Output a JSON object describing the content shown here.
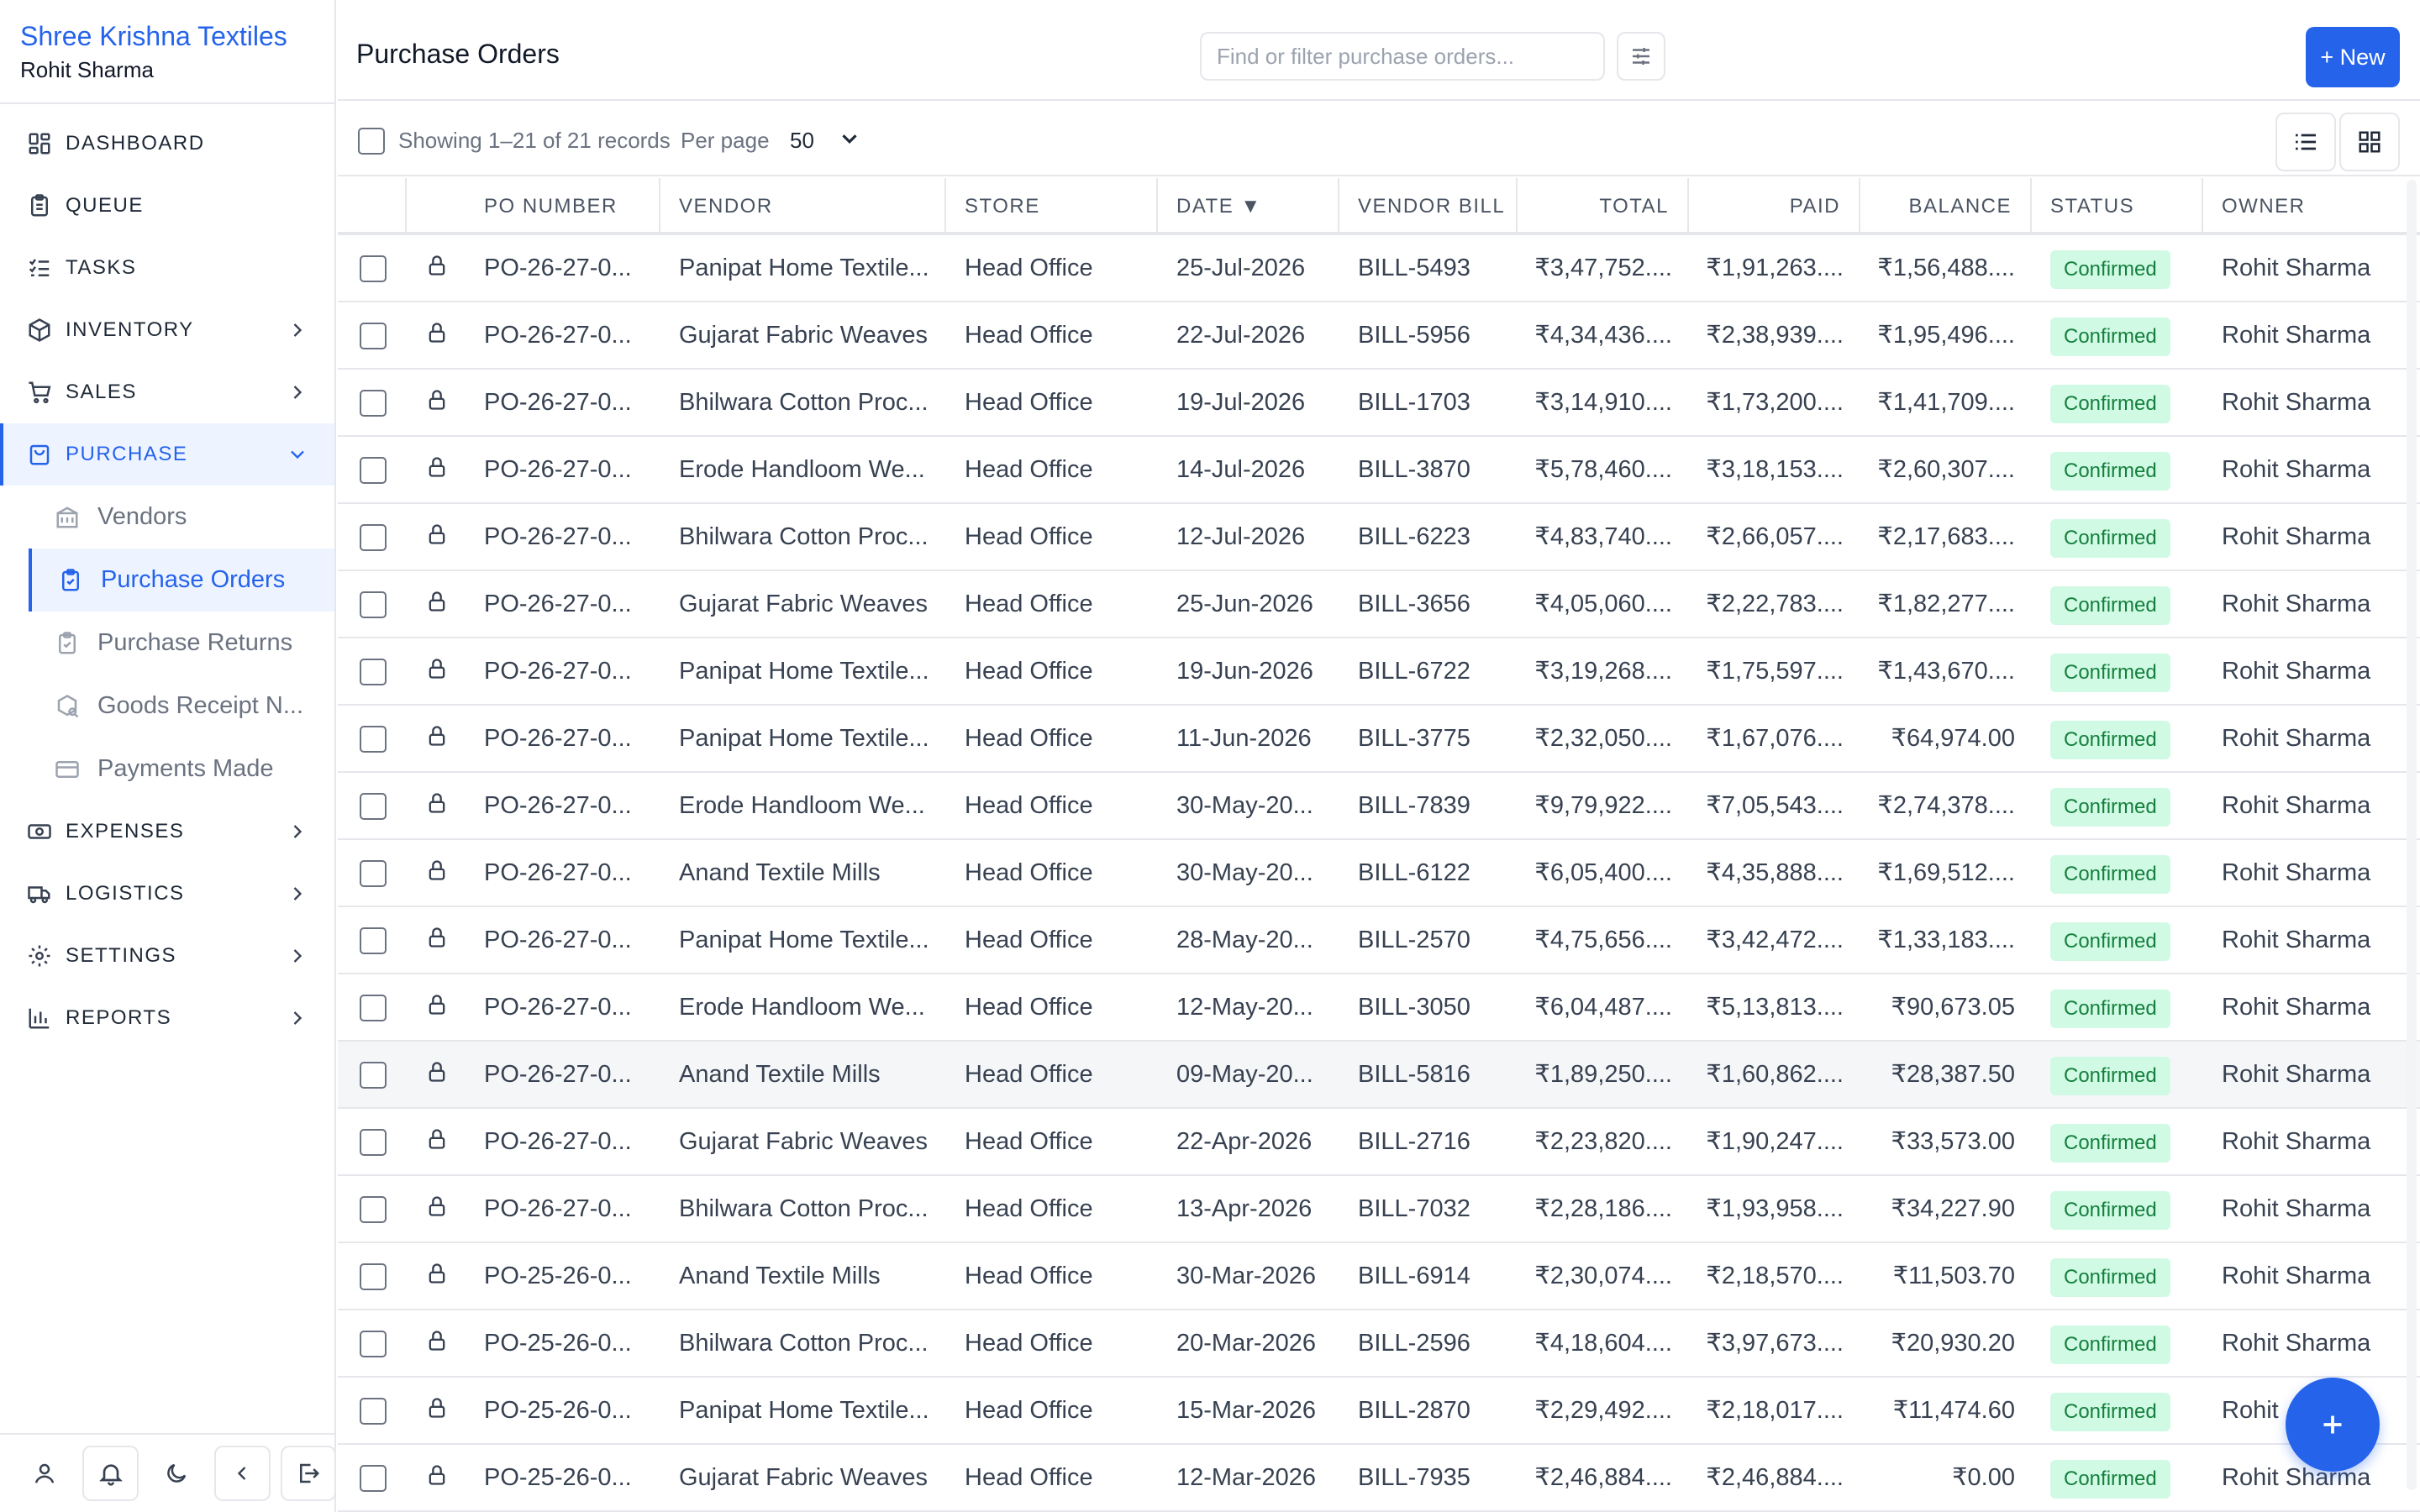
{
  "sidebar": {
    "org_name": "Shree Krishna Textiles",
    "user_name": "Rohit Sharma",
    "nav": [
      {
        "label": "DASHBOARD",
        "icon": "dashboard-icon"
      },
      {
        "label": "QUEUE",
        "icon": "clipboard-icon"
      },
      {
        "label": "TASKS",
        "icon": "list-check-icon"
      },
      {
        "label": "INVENTORY",
        "icon": "box-icon"
      },
      {
        "label": "SALES",
        "icon": "cart-icon"
      },
      {
        "label": "PURCHASE",
        "icon": "bag-icon"
      },
      {
        "label": "EXPENSES",
        "icon": "cash-icon"
      },
      {
        "label": "LOGISTICS",
        "icon": "truck-icon"
      },
      {
        "label": "SETTINGS",
        "icon": "gear-icon"
      },
      {
        "label": "REPORTS",
        "icon": "bar-chart-icon"
      }
    ],
    "purchase_sub": [
      {
        "label": "Vendors"
      },
      {
        "label": "Purchase Orders"
      },
      {
        "label": "Purchase Returns"
      },
      {
        "label": "Goods Receipt N..."
      },
      {
        "label": "Payments Made"
      }
    ]
  },
  "header": {
    "title": "Purchase Orders",
    "search_placeholder": "Find or filter purchase orders...",
    "new_label": "+ New"
  },
  "toolbar": {
    "showing": "Showing 1–21 of 21 records",
    "per_page_label": "Per page",
    "per_page_value": "50"
  },
  "table": {
    "columns": {
      "po_number": "PO NUMBER",
      "vendor": "VENDOR",
      "store": "STORE",
      "date": "DATE ▼",
      "vendor_bill": "VENDOR BILL",
      "total": "TOTAL",
      "paid": "PAID",
      "balance": "BALANCE",
      "status": "STATUS",
      "owner": "OWNER"
    },
    "rows": [
      {
        "po": "PO-26-27-0...",
        "vendor": "Panipat Home Textile...",
        "store": "Head Office",
        "date": "25-Jul-2026",
        "bill": "BILL-5493",
        "total": "₹3,47,752....",
        "paid": "₹1,91,263....",
        "balance": "₹1,56,488....",
        "status": "Confirmed",
        "owner": "Rohit Sharma"
      },
      {
        "po": "PO-26-27-0...",
        "vendor": "Gujarat Fabric Weaves",
        "store": "Head Office",
        "date": "22-Jul-2026",
        "bill": "BILL-5956",
        "total": "₹4,34,436....",
        "paid": "₹2,38,939....",
        "balance": "₹1,95,496....",
        "status": "Confirmed",
        "owner": "Rohit Sharma"
      },
      {
        "po": "PO-26-27-0...",
        "vendor": "Bhilwara Cotton Proc...",
        "store": "Head Office",
        "date": "19-Jul-2026",
        "bill": "BILL-1703",
        "total": "₹3,14,910....",
        "paid": "₹1,73,200....",
        "balance": "₹1,41,709....",
        "status": "Confirmed",
        "owner": "Rohit Sharma"
      },
      {
        "po": "PO-26-27-0...",
        "vendor": "Erode Handloom We...",
        "store": "Head Office",
        "date": "14-Jul-2026",
        "bill": "BILL-3870",
        "total": "₹5,78,460....",
        "paid": "₹3,18,153....",
        "balance": "₹2,60,307....",
        "status": "Confirmed",
        "owner": "Rohit Sharma"
      },
      {
        "po": "PO-26-27-0...",
        "vendor": "Bhilwara Cotton Proc...",
        "store": "Head Office",
        "date": "12-Jul-2026",
        "bill": "BILL-6223",
        "total": "₹4,83,740....",
        "paid": "₹2,66,057....",
        "balance": "₹2,17,683....",
        "status": "Confirmed",
        "owner": "Rohit Sharma"
      },
      {
        "po": "PO-26-27-0...",
        "vendor": "Gujarat Fabric Weaves",
        "store": "Head Office",
        "date": "25-Jun-2026",
        "bill": "BILL-3656",
        "total": "₹4,05,060....",
        "paid": "₹2,22,783....",
        "balance": "₹1,82,277....",
        "status": "Confirmed",
        "owner": "Rohit Sharma"
      },
      {
        "po": "PO-26-27-0...",
        "vendor": "Panipat Home Textile...",
        "store": "Head Office",
        "date": "19-Jun-2026",
        "bill": "BILL-6722",
        "total": "₹3,19,268....",
        "paid": "₹1,75,597....",
        "balance": "₹1,43,670....",
        "status": "Confirmed",
        "owner": "Rohit Sharma"
      },
      {
        "po": "PO-26-27-0...",
        "vendor": "Panipat Home Textile...",
        "store": "Head Office",
        "date": "11-Jun-2026",
        "bill": "BILL-3775",
        "total": "₹2,32,050....",
        "paid": "₹1,67,076....",
        "balance": "₹64,974.00",
        "status": "Confirmed",
        "owner": "Rohit Sharma"
      },
      {
        "po": "PO-26-27-0...",
        "vendor": "Erode Handloom We...",
        "store": "Head Office",
        "date": "30-May-20...",
        "bill": "BILL-7839",
        "total": "₹9,79,922....",
        "paid": "₹7,05,543....",
        "balance": "₹2,74,378....",
        "status": "Confirmed",
        "owner": "Rohit Sharma"
      },
      {
        "po": "PO-26-27-0...",
        "vendor": "Anand Textile Mills",
        "store": "Head Office",
        "date": "30-May-20...",
        "bill": "BILL-6122",
        "total": "₹6,05,400....",
        "paid": "₹4,35,888....",
        "balance": "₹1,69,512....",
        "status": "Confirmed",
        "owner": "Rohit Sharma"
      },
      {
        "po": "PO-26-27-0...",
        "vendor": "Panipat Home Textile...",
        "store": "Head Office",
        "date": "28-May-20...",
        "bill": "BILL-2570",
        "total": "₹4,75,656....",
        "paid": "₹3,42,472....",
        "balance": "₹1,33,183....",
        "status": "Confirmed",
        "owner": "Rohit Sharma"
      },
      {
        "po": "PO-26-27-0...",
        "vendor": "Erode Handloom We...",
        "store": "Head Office",
        "date": "12-May-20...",
        "bill": "BILL-3050",
        "total": "₹6,04,487....",
        "paid": "₹5,13,813....",
        "balance": "₹90,673.05",
        "status": "Confirmed",
        "owner": "Rohit Sharma"
      },
      {
        "po": "PO-26-27-0...",
        "vendor": "Anand Textile Mills",
        "store": "Head Office",
        "date": "09-May-20...",
        "bill": "BILL-5816",
        "total": "₹1,89,250....",
        "paid": "₹1,60,862....",
        "balance": "₹28,387.50",
        "status": "Confirmed",
        "owner": "Rohit Sharma"
      },
      {
        "po": "PO-26-27-0...",
        "vendor": "Gujarat Fabric Weaves",
        "store": "Head Office",
        "date": "22-Apr-2026",
        "bill": "BILL-2716",
        "total": "₹2,23,820....",
        "paid": "₹1,90,247....",
        "balance": "₹33,573.00",
        "status": "Confirmed",
        "owner": "Rohit Sharma"
      },
      {
        "po": "PO-26-27-0...",
        "vendor": "Bhilwara Cotton Proc...",
        "store": "Head Office",
        "date": "13-Apr-2026",
        "bill": "BILL-7032",
        "total": "₹2,28,186....",
        "paid": "₹1,93,958....",
        "balance": "₹34,227.90",
        "status": "Confirmed",
        "owner": "Rohit Sharma"
      },
      {
        "po": "PO-25-26-0...",
        "vendor": "Anand Textile Mills",
        "store": "Head Office",
        "date": "30-Mar-2026",
        "bill": "BILL-6914",
        "total": "₹2,30,074....",
        "paid": "₹2,18,570....",
        "balance": "₹11,503.70",
        "status": "Confirmed",
        "owner": "Rohit Sharma"
      },
      {
        "po": "PO-25-26-0...",
        "vendor": "Bhilwara Cotton Proc...",
        "store": "Head Office",
        "date": "20-Mar-2026",
        "bill": "BILL-2596",
        "total": "₹4,18,604....",
        "paid": "₹3,97,673....",
        "balance": "₹20,930.20",
        "status": "Confirmed",
        "owner": "Rohit Sharma"
      },
      {
        "po": "PO-25-26-0...",
        "vendor": "Panipat Home Textile...",
        "store": "Head Office",
        "date": "15-Mar-2026",
        "bill": "BILL-2870",
        "total": "₹2,29,492....",
        "paid": "₹2,18,017....",
        "balance": "₹11,474.60",
        "status": "Confirmed",
        "owner": "Rohit"
      },
      {
        "po": "PO-25-26-0...",
        "vendor": "Gujarat Fabric Weaves",
        "store": "Head Office",
        "date": "12-Mar-2026",
        "bill": "BILL-7935",
        "total": "₹2,46,884....",
        "paid": "₹2,46,884....",
        "balance": "₹0.00",
        "status": "Confirmed",
        "owner": "Rohit Sharma"
      }
    ]
  },
  "colors": {
    "accent": "#2563eb",
    "status_bg": "#d1fae5",
    "status_text": "#15803d"
  }
}
